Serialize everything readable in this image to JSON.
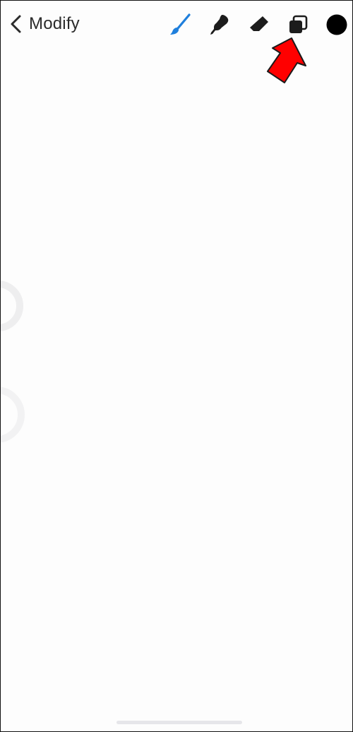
{
  "topbar": {
    "back_label": "Modify",
    "tools": [
      {
        "name": "brush",
        "icon": "paintbrush-icon",
        "color": "#1f7fdc",
        "active": true
      },
      {
        "name": "smudge",
        "icon": "smudge-icon",
        "color": "#1c1c1c",
        "active": false
      },
      {
        "name": "eraser",
        "icon": "eraser-icon",
        "color": "#1c1c1c",
        "active": false
      },
      {
        "name": "layers",
        "icon": "layers-icon",
        "color": "#1c1c1c",
        "active": false
      },
      {
        "name": "color",
        "icon": "color-swatch",
        "color": "#000000",
        "active": false
      }
    ]
  },
  "annotation": {
    "icon": "red-arrow-annotation",
    "color": "#ff0000",
    "points_to": "layers"
  }
}
